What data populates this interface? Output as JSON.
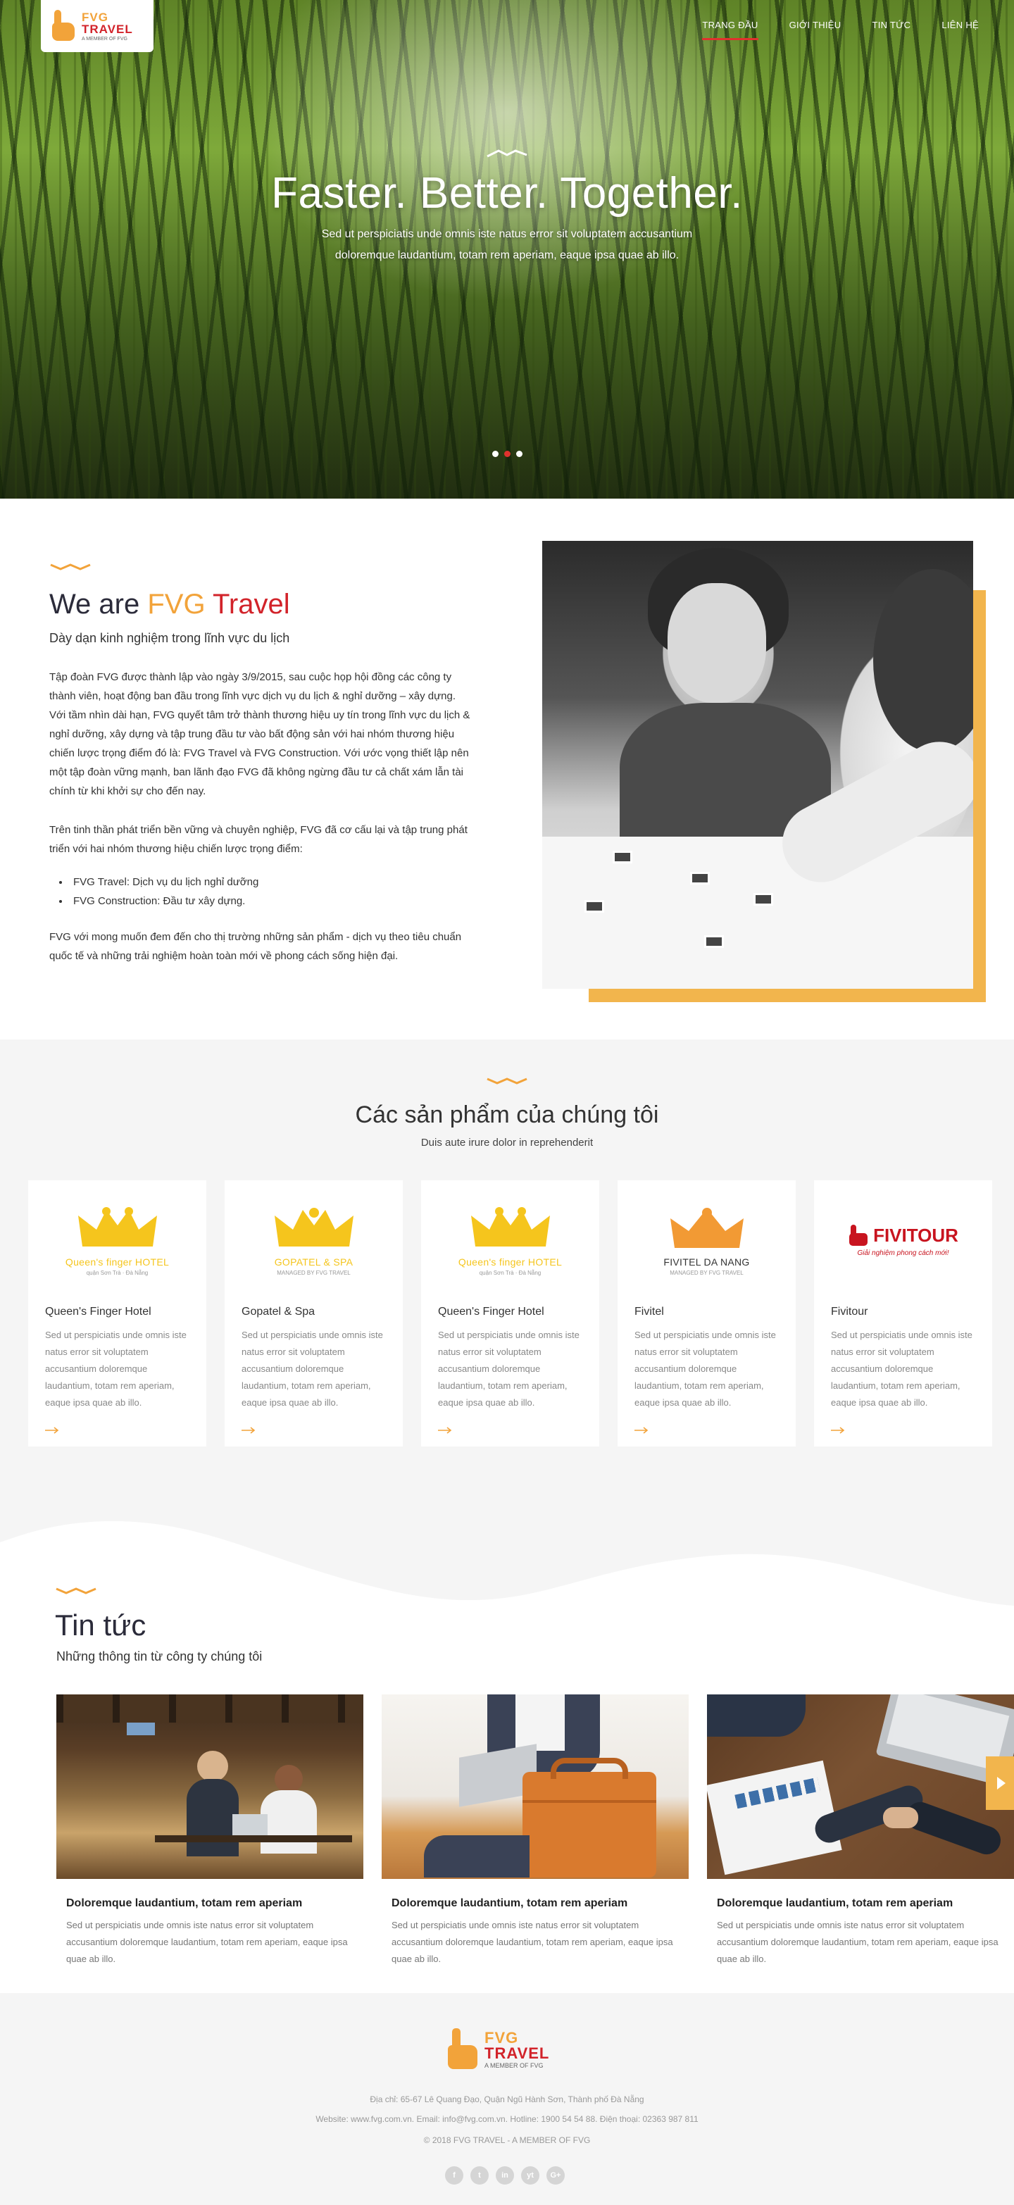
{
  "brand": {
    "name_top": "FVG",
    "name_bottom": "TRAVEL",
    "tagline": "A MEMBER OF FVG"
  },
  "nav": {
    "items": [
      "TRANG ĐẦU",
      "GIỚI THIỆU",
      "TIN TỨC",
      "LIÊN HỆ"
    ],
    "active_index": 0
  },
  "hero": {
    "title": "Faster. Better. Together.",
    "text": "Sed ut perspiciatis unde omnis iste natus error sit voluptatem accusantium doloremque laudantium, totam rem aperiam, eaque ipsa quae ab illo.",
    "slides": 3,
    "active_slide": 1
  },
  "about": {
    "title_prefix": "We are",
    "title_brand_1": "FVG",
    "title_brand_2": "Travel",
    "subtitle": "Dày dạn kinh nghiệm trong lĩnh vực du lịch",
    "p1": "Tập đoàn FVG được thành lập vào ngày 3/9/2015, sau cuộc họp hội đồng các công ty thành viên, hoạt động ban đầu trong lĩnh vực dịch vụ du lịch & nghỉ dưỡng – xây dựng. Với tầm nhìn dài hạn, FVG quyết tâm trở thành thương hiệu uy tín trong lĩnh vực du lịch & nghỉ dưỡng, xây dựng và tập trung đầu tư vào bất động sản với hai nhóm thương hiệu chiến lược trọng điểm đó là: FVG Travel và FVG Construction. Với ước vọng thiết lập nên một tập đoàn vững mạnh, ban lãnh đạo FVG đã không ngừng đầu tư cả chất xám lẫn tài chính từ khi khởi sự cho đến nay.",
    "p2": "Trên tinh thần phát triển bền vững và chuyên nghiệp, FVG đã cơ cấu lại và tập trung phát triển với hai nhóm thương hiệu chiến lược trọng điểm:",
    "bullets": [
      "FVG Travel: Dịch vụ du lịch nghỉ dưỡng",
      "FVG Construction: Đầu tư xây dựng."
    ],
    "p3": "FVG với mong muốn đem đến cho thị trường những sản phẩm - dịch vụ theo tiêu chuẩn quốc tế và những trải nghiệm hoàn toàn mới về phong cách sống hiện đại."
  },
  "products": {
    "title": "Các sản phẩm của chúng tôi",
    "subtitle": "Duis aute irure dolor in reprehenderit",
    "items": [
      {
        "name": "Queen's Finger Hotel",
        "logo_main": "Queen's finger HOTEL",
        "logo_sub": "quận Sơn Trà · Đà Nẵng",
        "logo_color": "#f5c51d",
        "desc": "Sed ut perspiciatis unde omnis iste natus error sit voluptatem accusantium doloremque laudantium, totam rem aperiam, eaque ipsa quae ab illo."
      },
      {
        "name": "Gopatel & Spa",
        "logo_main": "GOPATEL & SPA",
        "logo_sub": "MANAGED BY FVG TRAVEL",
        "logo_color": "#f5c51d",
        "desc": "Sed ut perspiciatis unde omnis iste natus error sit voluptatem accusantium doloremque laudantium, totam rem aperiam, eaque ipsa quae ab illo."
      },
      {
        "name": "Queen's Finger Hotel",
        "logo_main": "Queen's finger HOTEL",
        "logo_sub": "quận Sơn Trà · Đà Nẵng",
        "logo_color": "#f5c51d",
        "desc": "Sed ut perspiciatis unde omnis iste natus error sit voluptatem accusantium doloremque laudantium, totam rem aperiam, eaque ipsa quae ab illo."
      },
      {
        "name": "Fivitel",
        "logo_main": "FIVITEL DA NANG",
        "logo_sub": "MANAGED BY FVG TRAVEL",
        "logo_color": "#f29a34",
        "desc": "Sed ut perspiciatis unde omnis iste natus error sit voluptatem accusantium doloremque laudantium, totam rem aperiam, eaque ipsa quae ab illo."
      },
      {
        "name": "Fivitour",
        "logo_main": "FIVITOUR",
        "logo_sub": "Giải nghiệm phong cách mới!",
        "logo_color": "#c8141f",
        "desc": "Sed ut perspiciatis unde omnis iste natus error sit voluptatem accusantium doloremque laudantium, totam rem aperiam, eaque ipsa quae ab illo."
      }
    ]
  },
  "news": {
    "title": "Tin tức",
    "subtitle": "Những thông tin từ công ty chúng tôi",
    "items": [
      {
        "title": "Doloremque laudantium, totam rem aperiam",
        "desc": "Sed ut perspiciatis unde omnis iste natus error sit voluptatem accusantium doloremque laudantium, totam rem aperiam, eaque ipsa quae ab illo."
      },
      {
        "title": "Doloremque laudantium, totam rem aperiam",
        "desc": "Sed ut perspiciatis unde omnis iste natus error sit voluptatem accusantium doloremque laudantium, totam rem aperiam, eaque ipsa quae ab illo."
      },
      {
        "title": "Doloremque laudantium, totam rem aperiam",
        "desc": "Sed ut perspiciatis unde omnis iste natus error sit voluptatem accusantium doloremque laudantium, totam rem aperiam, eaque ipsa quae ab illo."
      }
    ]
  },
  "footer": {
    "address": "Địa chỉ: 65-67 Lê Quang Đạo, Quận Ngũ Hành Sơn, Thành phố Đà Nẵng",
    "contact": "Website: www.fvg.com.vn. Email: info@fvg.com.vn. Hotline: 1900 54 54 88. Điện thoại: 02363 987 811",
    "copyright": "© 2018 FVG TRAVEL - A MEMBER OF FVG",
    "socials": [
      "f",
      "t",
      "in",
      "yt",
      "G+"
    ]
  },
  "colors": {
    "accent": "#f2a33a",
    "brand_red": "#d2232a",
    "nav_active": "#e0322e",
    "photo_frame": "#f2b54d"
  }
}
